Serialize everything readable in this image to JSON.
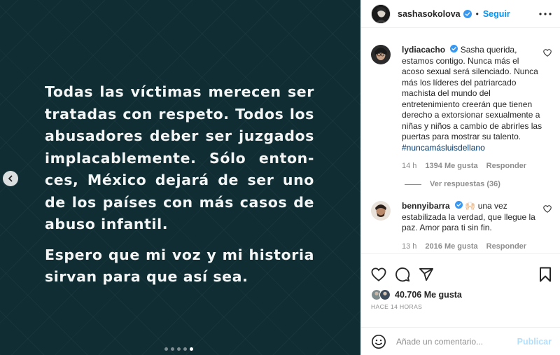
{
  "post": {
    "media_paragraphs": [
      "Todas las víctimas merecen ser tratadas con respeto. Todos los abusadores deber ser juzgados implacablemente. Sólo enton-ces, México dejará de ser uno de los países con más casos de abuso infantil.",
      "Espero que mi voz y mi historia sirvan para que así sea."
    ],
    "carousel": {
      "total": 5,
      "current": 5
    }
  },
  "header": {
    "username": "sashasokolova",
    "separator": "•",
    "follow_label": "Seguir"
  },
  "comments": [
    {
      "username": "lydiacacho",
      "text": "Sasha querida, estamos contigo. Nunca más el acoso sexual será silenciado. Nunca más los líderes del patriarcado machista del mundo del entretenimiento creerán que tienen derecho a extorsionar sexualmente a niñas y niños a cambio de abrirles las puertas para mostrar su talento.",
      "hashtag": "#nuncamásluisdellano",
      "time": "14 h",
      "likes": "1394 Me gusta",
      "reply_label": "Responder",
      "view_replies": "Ver respuestas (36)"
    },
    {
      "username": "bennyibarra",
      "emoji": "🙌🏻",
      "text": "una vez estabilizada la verdad, que llegue la paz. Amor para ti sin fin.",
      "time": "13 h",
      "likes": "2016 Me gusta",
      "reply_label": "Responder"
    }
  ],
  "footer": {
    "likes": "40.706 Me gusta",
    "timestamp": "HACE 14 HORAS",
    "comment_placeholder": "Añade un comentario...",
    "publish_label": "Publicar"
  },
  "colors": {
    "accent": "#0095f6",
    "verified": "#3897f0",
    "publish_disabled": "#b2dffc",
    "hashtag": "#00376b",
    "media_bg": "#0f2d33"
  },
  "icons": [
    "chevron-left-icon",
    "more-icon",
    "verified-icon",
    "heart-icon",
    "comment-icon",
    "share-icon",
    "bookmark-icon",
    "emoji-icon"
  ]
}
